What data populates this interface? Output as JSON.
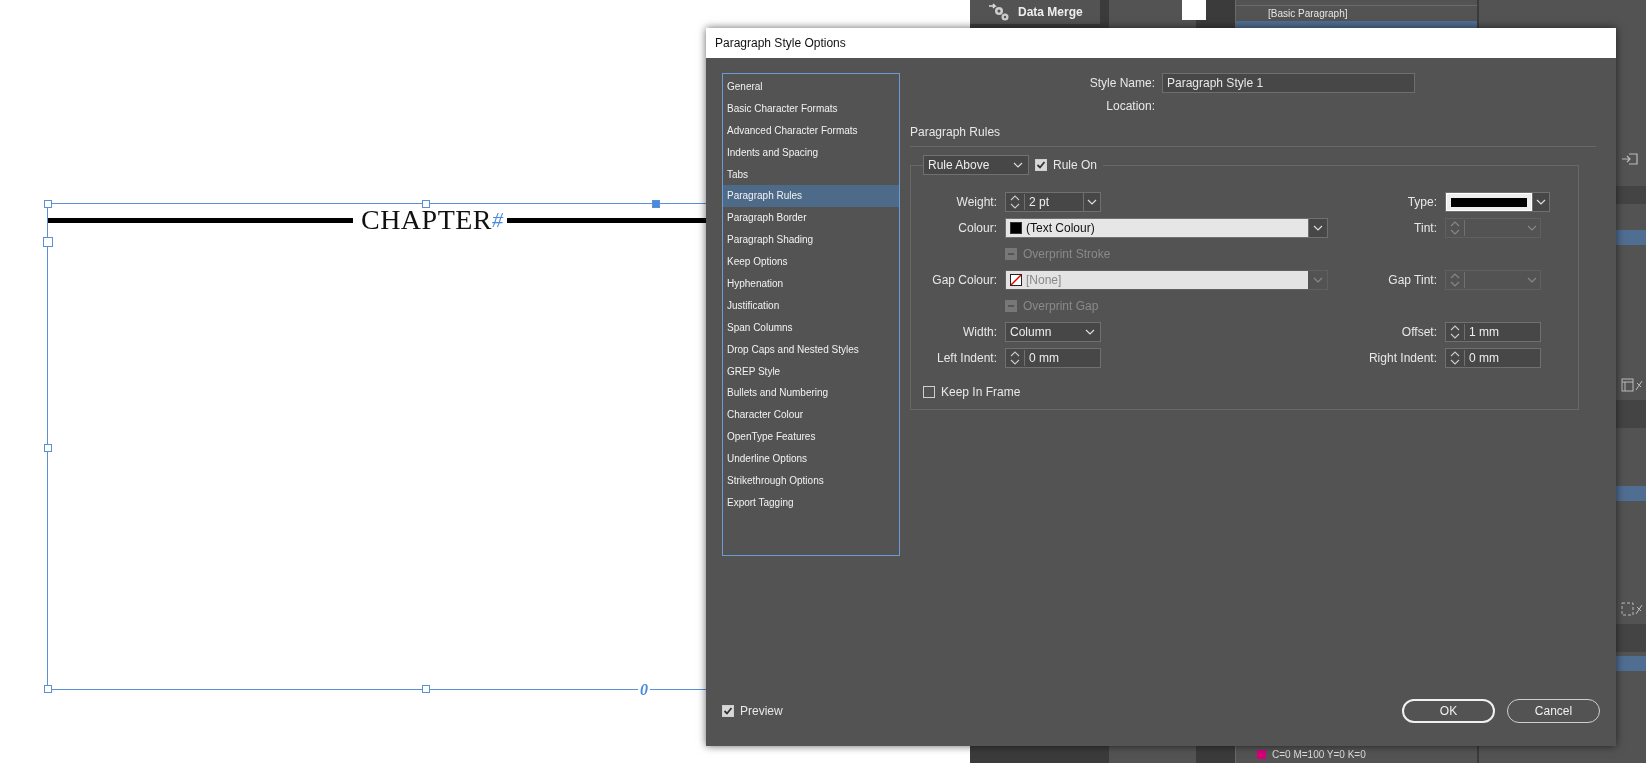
{
  "document": {
    "heading": "CHAPTER",
    "marker": "#",
    "footer_marker": "0"
  },
  "panels": {
    "data_merge": "Data Merge",
    "styles": [
      {
        "label": "[Basic Paragraph]",
        "selected": false
      }
    ],
    "swatches": [
      {
        "name": "C=0 M=100 Y=0 K=0",
        "color": "#d4007a"
      }
    ]
  },
  "dialog": {
    "title": "Paragraph Style Options",
    "categories": [
      {
        "label": "General",
        "selected": false
      },
      {
        "label": "Basic Character Formats",
        "selected": false
      },
      {
        "label": "Advanced Character Formats",
        "selected": false
      },
      {
        "label": "Indents and Spacing",
        "selected": false
      },
      {
        "label": "Tabs",
        "selected": false
      },
      {
        "label": "Paragraph Rules",
        "selected": true
      },
      {
        "label": "Paragraph Border",
        "selected": false
      },
      {
        "label": "Paragraph Shading",
        "selected": false
      },
      {
        "label": "Keep Options",
        "selected": false
      },
      {
        "label": "Hyphenation",
        "selected": false
      },
      {
        "label": "Justification",
        "selected": false
      },
      {
        "label": "Span Columns",
        "selected": false
      },
      {
        "label": "Drop Caps and Nested Styles",
        "selected": false
      },
      {
        "label": "GREP Style",
        "selected": false
      },
      {
        "label": "Bullets and Numbering",
        "selected": false
      },
      {
        "label": "Character Colour",
        "selected": false
      },
      {
        "label": "OpenType Features",
        "selected": false
      },
      {
        "label": "Underline Options",
        "selected": false
      },
      {
        "label": "Strikethrough Options",
        "selected": false
      },
      {
        "label": "Export Tagging",
        "selected": false
      }
    ],
    "style_name": {
      "label": "Style Name:",
      "value": "Paragraph Style 1"
    },
    "location": {
      "label": "Location:"
    },
    "section": "Paragraph Rules",
    "rule_select": "Rule Above",
    "rule_on": {
      "label": "Rule On",
      "checked": true
    },
    "rows": [
      {
        "left": {
          "kind": "spin-combo",
          "label": "Weight:",
          "value": "2 pt",
          "disabled": false
        },
        "right": {
          "kind": "stroke",
          "label": "Type:"
        }
      },
      {
        "left": {
          "kind": "color",
          "label": "Colour:",
          "value": "(Text Colour)",
          "no_colour": false,
          "disabled": false
        },
        "right": {
          "kind": "spin-combo",
          "label": "Tint:",
          "disabled": true
        }
      },
      {
        "left": {
          "kind": "checkbox",
          "label": "Overprint Stroke",
          "checked": false,
          "disabled": true
        }
      },
      {
        "left": {
          "kind": "color",
          "label": "Gap Colour:",
          "value": "[None]",
          "no_colour": true,
          "disabled": true
        },
        "right": {
          "kind": "spin-combo",
          "label": "Gap Tint:",
          "disabled": true
        }
      },
      {
        "left": {
          "kind": "checkbox",
          "label": "Overprint Gap",
          "checked": false,
          "disabled": true
        }
      },
      {
        "left": {
          "kind": "select",
          "label": "Width:",
          "value": "Column",
          "disabled": false
        },
        "right": {
          "kind": "spin",
          "label": "Offset:",
          "value": "1 mm",
          "disabled": false
        }
      },
      {
        "left": {
          "kind": "spin",
          "label": "Left Indent:",
          "value": "0 mm",
          "disabled": false
        },
        "right": {
          "kind": "spin",
          "label": "Right Indent:",
          "value": "0 mm",
          "disabled": false
        }
      }
    ],
    "keep_in_frame": {
      "label": "Keep In Frame",
      "checked": false
    },
    "preview": {
      "label": "Preview",
      "checked": true
    },
    "buttons": [
      "OK",
      "Cancel"
    ]
  }
}
